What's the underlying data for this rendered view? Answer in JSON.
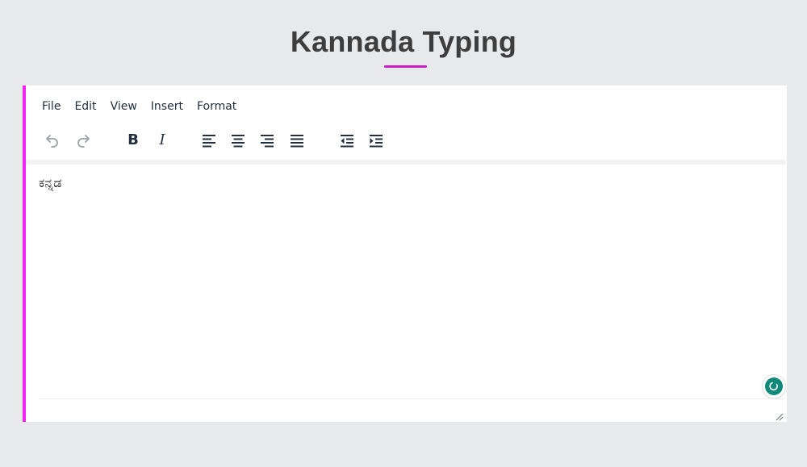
{
  "page": {
    "title": "Kannada Typing"
  },
  "colors": {
    "accent": "#f321f3",
    "title_underline": "#c81fc8",
    "assist_badge": "#11897a"
  },
  "menubar": {
    "items": [
      {
        "label": "File"
      },
      {
        "label": "Edit"
      },
      {
        "label": "View"
      },
      {
        "label": "Insert"
      },
      {
        "label": "Format"
      }
    ]
  },
  "toolbar": {
    "bold_label": "B",
    "italic_label": "I",
    "icons": [
      "undo-icon",
      "redo-icon",
      "bold-icon",
      "italic-icon",
      "align-left-icon",
      "align-center-icon",
      "align-right-icon",
      "align-justify-icon",
      "outdent-icon",
      "indent-icon"
    ]
  },
  "editor": {
    "content": "ಕನ್ನಡ"
  }
}
